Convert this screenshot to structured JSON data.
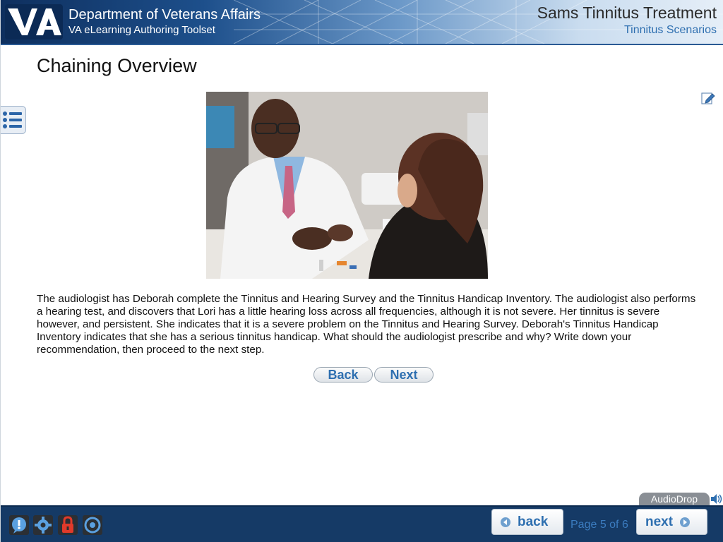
{
  "header": {
    "org": "Department of Veterans Affairs",
    "tool": "VA eLearning Authoring Toolset",
    "course_title": "Sams Tinnitus Treatment",
    "course_subtitle": "Tinnitus Scenarios",
    "logo_text": "VA"
  },
  "page": {
    "title": "Chaining Overview",
    "body": "The audiologist has Deborah complete the Tinnitus and Hearing Survey and the Tinnitus Handicap Inventory.  The audiologist also performs a hearing test, and discovers that Lori has a  little hearing loss across all frequencies, although it is not severe.  Her tinnitus is severe however, and persistent.  She indicates that it is a severe problem on the Tinnitus and Hearing Survey.  Deborah's Tinnitus Handicap Inventory indicates that she has a serious tinnitus handicap.  What should the audiologist prescribe and why? Write down your recommendation, then proceed to the next step.",
    "back_label": "Back",
    "next_label": "Next"
  },
  "audiodrop": {
    "label": "AudioDrop"
  },
  "footer": {
    "back_label": "back",
    "next_label": "next",
    "page_indicator": "Page 5 of 6",
    "icons": [
      "help-icon",
      "settings-icon",
      "lock-icon",
      "target-icon"
    ]
  },
  "colors": {
    "header_dark": "#0e2f5e",
    "footer": "#153a66",
    "link_blue": "#2e6fb0"
  }
}
